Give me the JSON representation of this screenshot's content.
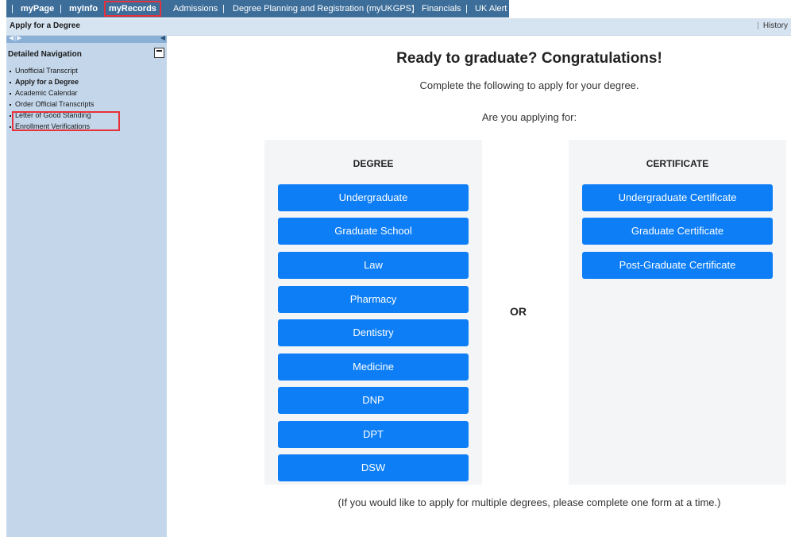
{
  "topnav": {
    "items": [
      {
        "label": "myPage"
      },
      {
        "label": "myInfo"
      },
      {
        "label": "myRecords"
      },
      {
        "label": "Admissions"
      },
      {
        "label": "Degree Planning and Registration (myUKGPS)"
      },
      {
        "label": "Financials"
      },
      {
        "label": "UK Alert"
      }
    ],
    "separator": "|"
  },
  "subheader": {
    "title": "Apply for a Degree",
    "history_label": "History",
    "history_separator": "|"
  },
  "leftpane": {
    "title": "Detailed Navigation",
    "items": [
      {
        "label": "Unofficial Transcript"
      },
      {
        "label": "Apply for a Degree"
      },
      {
        "label": "Academic Calendar"
      },
      {
        "label": "Order Official Transcripts"
      },
      {
        "label": "Letter of Good Standing"
      },
      {
        "label": "Enrollment Verifications"
      }
    ]
  },
  "main": {
    "headline": "Ready to graduate? Congratulations!",
    "subtitle": "Complete the following to apply for your degree.",
    "question": "Are you applying for:",
    "or_label": "OR",
    "degree": {
      "title": "DEGREE",
      "buttons": [
        "Undergraduate",
        "Graduate School",
        "Law",
        "Pharmacy",
        "Dentistry",
        "Medicine",
        "DNP",
        "DPT",
        "DSW"
      ]
    },
    "certificate": {
      "title": "CERTIFICATE",
      "buttons": [
        "Undergraduate Certificate",
        "Graduate Certificate",
        "Post-Graduate Certificate"
      ]
    },
    "footnote": "(If you would like to apply for multiple degrees, please complete one form at a time.)"
  },
  "colors": {
    "nav_bar": "#3d6e9a",
    "highlight": "#e8313a",
    "button": "#0d7ef5",
    "left_pane": "#c3d6ea",
    "subheader": "#d6e4f2"
  }
}
